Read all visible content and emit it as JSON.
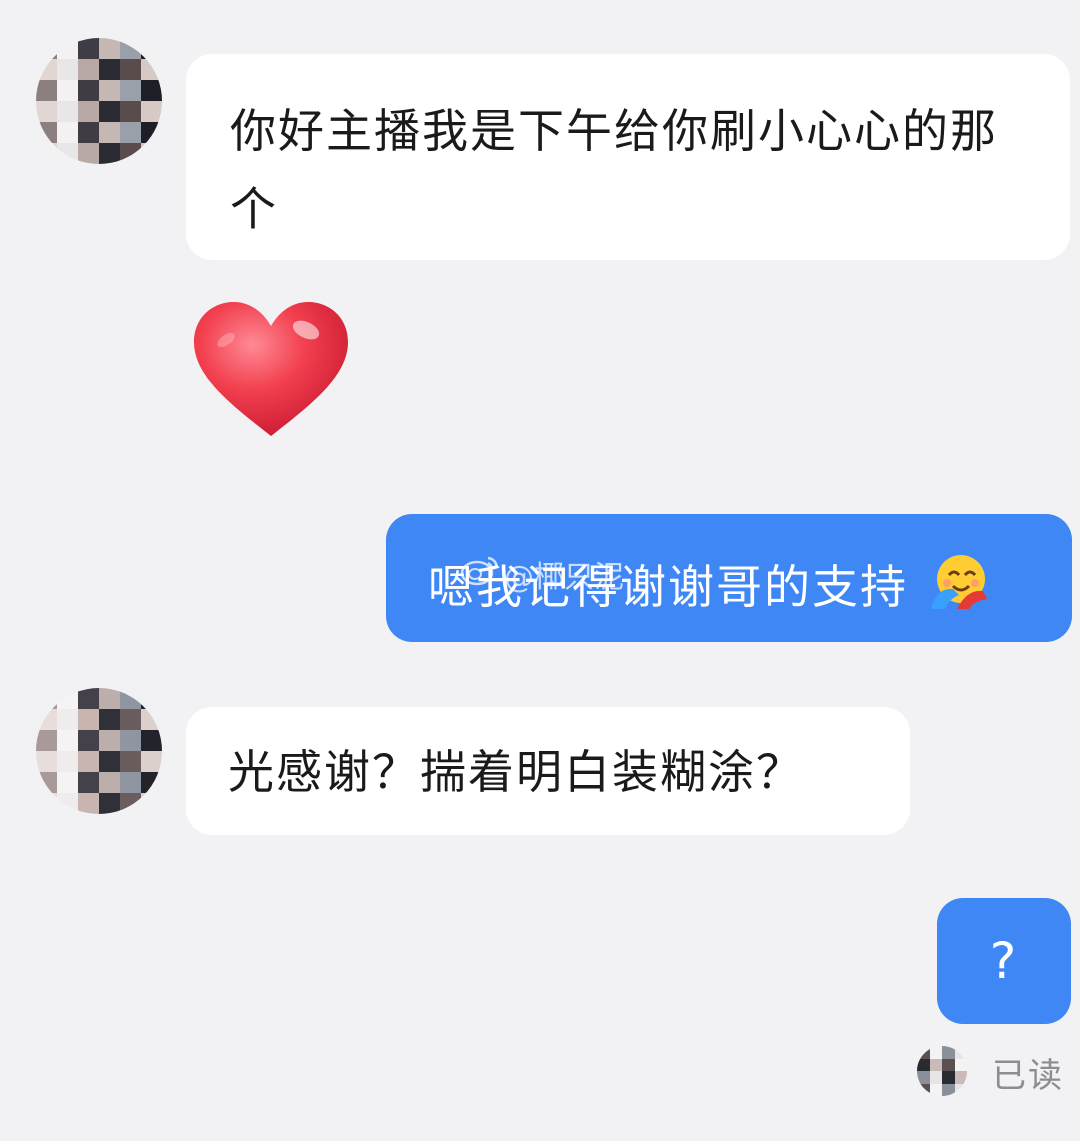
{
  "messages": [
    {
      "from": "other",
      "type": "text",
      "text": "你好主播我是下午给你刷小心心的那个"
    },
    {
      "from": "other",
      "type": "sticker",
      "sticker": "red-heart-icon"
    },
    {
      "from": "self",
      "type": "text",
      "text": "嗯我记得谢谢哥的支持",
      "emoji": "hugging-face-icon"
    },
    {
      "from": "other",
      "type": "text",
      "text": "光感谢？揣着明白装糊涂？"
    },
    {
      "from": "self",
      "type": "text",
      "text": "?"
    }
  ],
  "status": {
    "read_label": "已读"
  },
  "watermark": {
    "handle": "@椰只泥",
    "icon": "weibo-logo-icon"
  },
  "colors": {
    "background": "#f2f2f5",
    "incoming_bubble": "#ffffff",
    "outgoing_bubble": "#3f87f5",
    "heart": "#f0384a",
    "status_text": "#8c8c92"
  }
}
